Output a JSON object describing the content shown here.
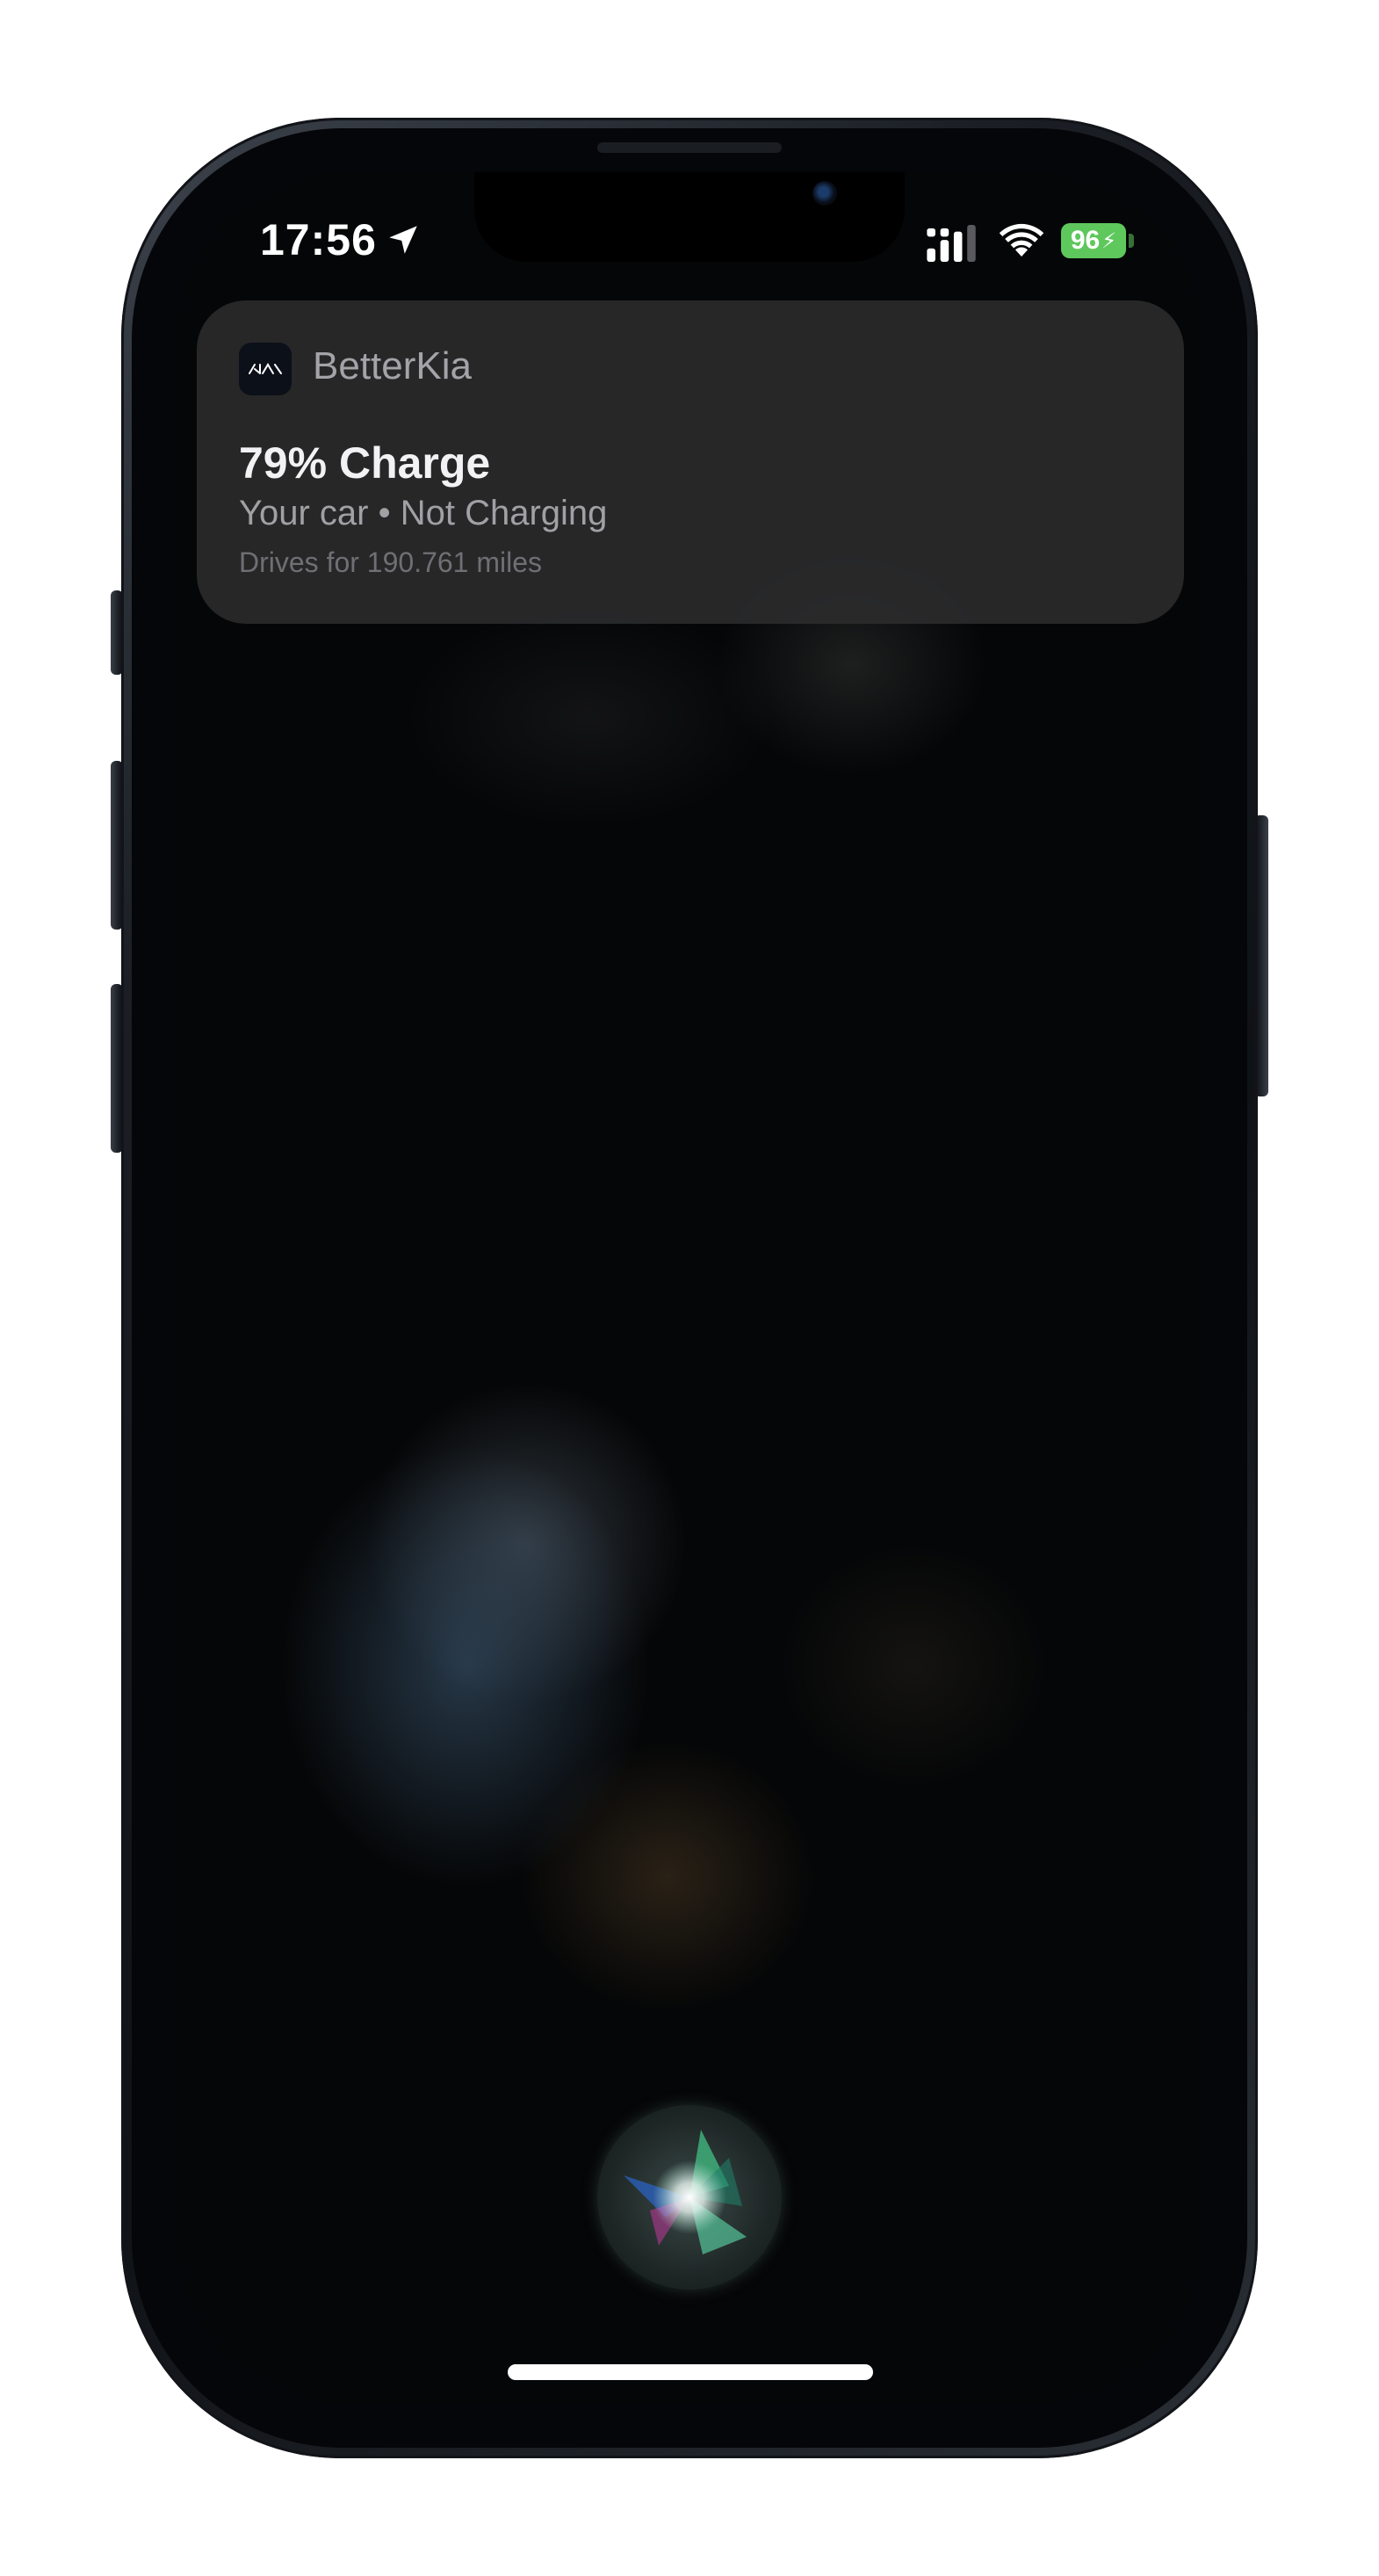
{
  "status_bar": {
    "time": "17:56",
    "battery_level": "96",
    "battery_charging": true,
    "icons": [
      "location-arrow-icon",
      "cellular-signal-icon",
      "wifi-icon",
      "battery-icon"
    ]
  },
  "notification": {
    "app_name": "BetterKia",
    "app_icon": "kia-logo-icon",
    "title": "79% Charge",
    "subtitle": "Your car • Not Charging",
    "detail": "Drives for 190.761 miles"
  },
  "siri": {
    "icon": "siri-orb-icon"
  },
  "colors": {
    "battery_green": "#5ec85c",
    "card_background": "#2c2c2e",
    "screen_background": "#050607"
  }
}
